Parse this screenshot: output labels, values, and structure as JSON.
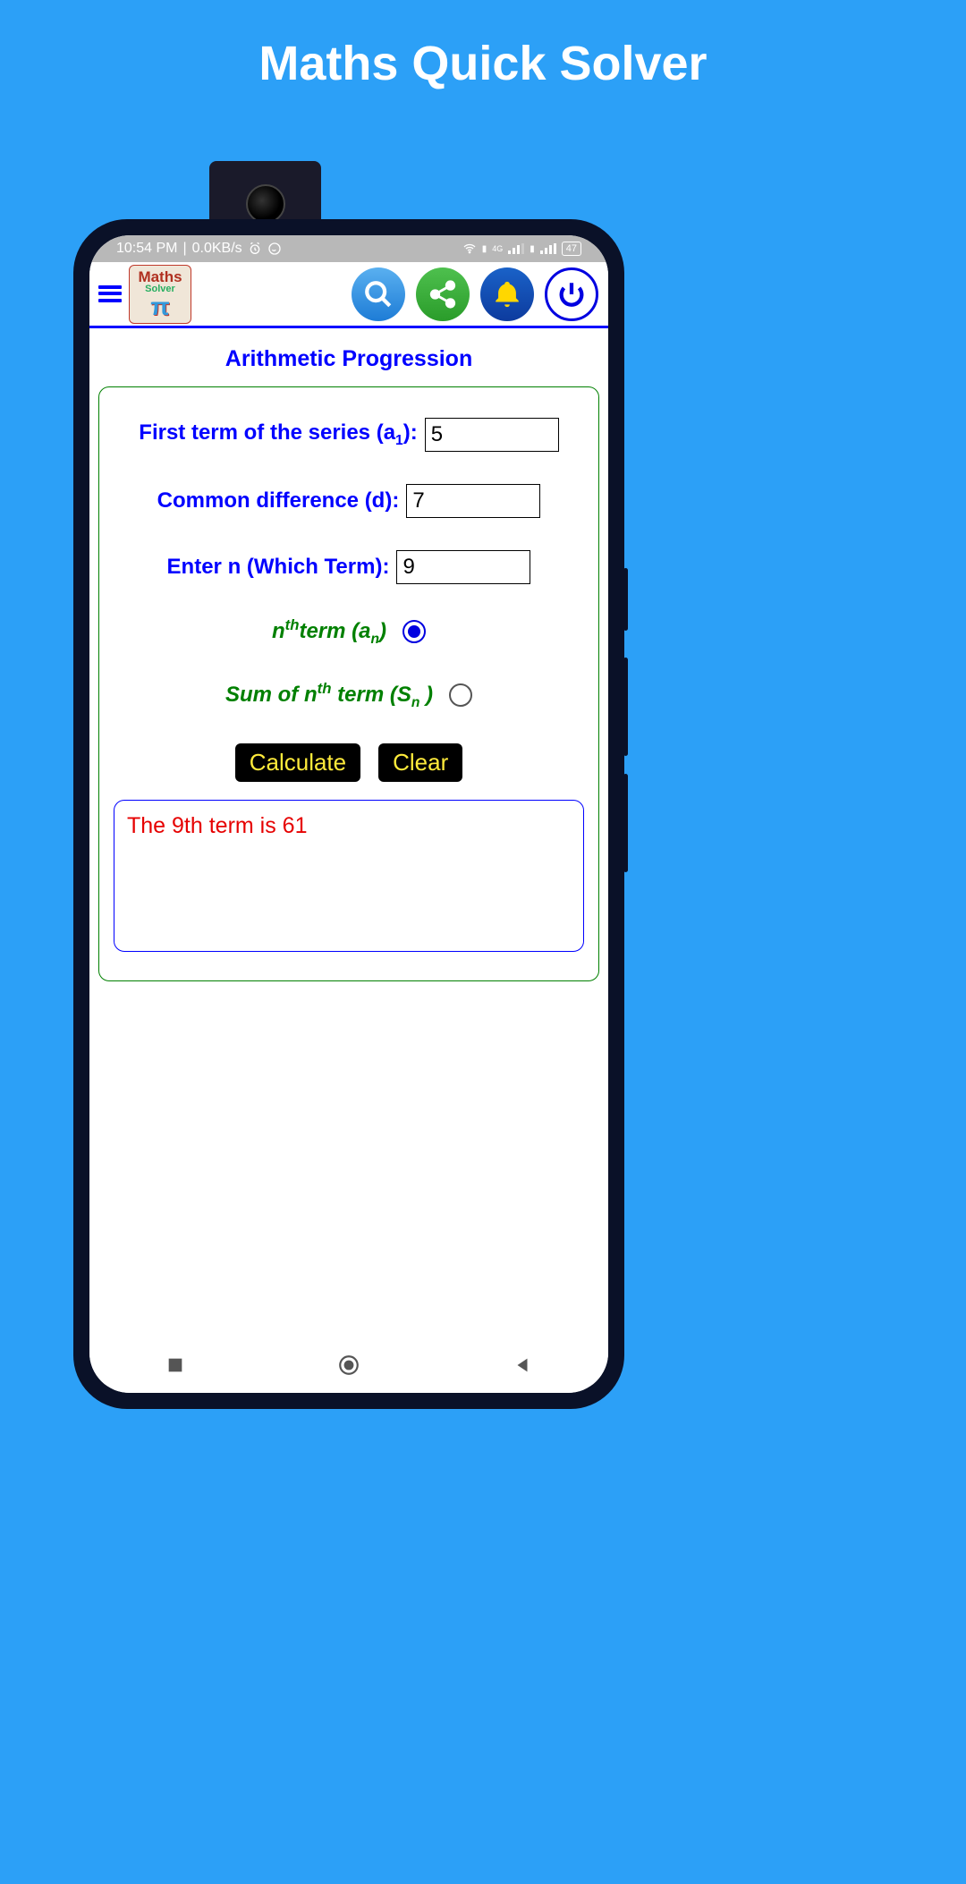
{
  "page": {
    "title": "Maths Quick Solver"
  },
  "status": {
    "time": "10:54 PM",
    "net": "0.0KB/s",
    "battery": "47"
  },
  "header": {
    "logo": {
      "line1": "Maths",
      "line2": "Solver",
      "pi": "π"
    }
  },
  "section": {
    "title": "Arithmetic Progression"
  },
  "fields": {
    "first_term": {
      "label": "First term of the series (a",
      "sub": "1",
      "label_end": "):",
      "value": "5"
    },
    "diff": {
      "label": "Common difference (d):",
      "value": "7"
    },
    "n": {
      "label": "Enter n (Which Term):",
      "value": "9"
    }
  },
  "radios": {
    "nth": {
      "label_pre": "n",
      "sup": "th",
      "label_mid": "term  (a",
      "sub": "n",
      "label_end": ")",
      "checked": true
    },
    "sum": {
      "label_pre": "Sum of n",
      "sup": "th",
      "label_mid": " term (S",
      "sub": "n",
      "label_end": " )",
      "checked": false
    }
  },
  "buttons": {
    "calculate": "Calculate",
    "clear": "Clear"
  },
  "result": "The 9th term is 61"
}
